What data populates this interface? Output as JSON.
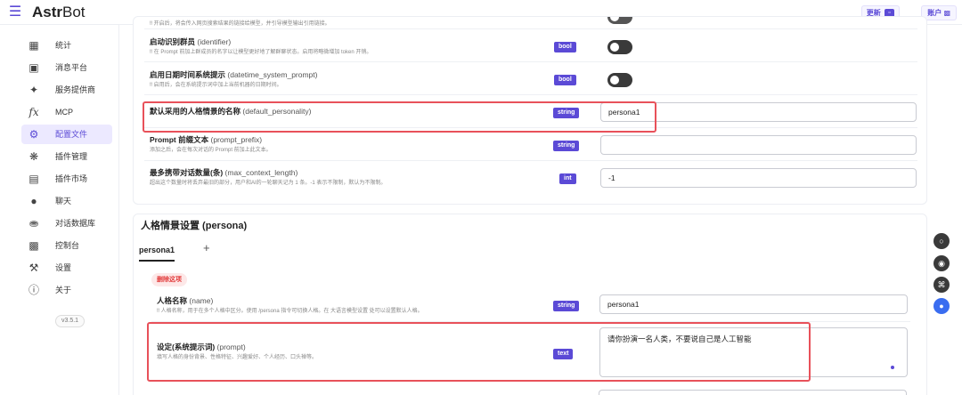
{
  "header": {
    "brand_bold": "Astr",
    "brand_rest": "Bot",
    "update_label": "更新",
    "account_label": "账户"
  },
  "sidebar": {
    "items": [
      {
        "label": "统计",
        "icon": "dashboard-icon"
      },
      {
        "label": "消息平台",
        "icon": "message-platform-icon"
      },
      {
        "label": "服务提供商",
        "icon": "provider-icon"
      },
      {
        "label": "MCP",
        "icon": "function-icon"
      },
      {
        "label": "配置文件",
        "icon": "gear-icon",
        "active": true
      },
      {
        "label": "插件管理",
        "icon": "puzzle-icon"
      },
      {
        "label": "插件市场",
        "icon": "store-icon"
      },
      {
        "label": "聊天",
        "icon": "chat-icon"
      },
      {
        "label": "对话数据库",
        "icon": "database-icon"
      },
      {
        "label": "控制台",
        "icon": "console-icon"
      },
      {
        "label": "设置",
        "icon": "wrench-icon"
      },
      {
        "label": "关于",
        "icon": "info-icon"
      }
    ],
    "version": "v3.5.1"
  },
  "settings": {
    "top_desc": "‼ 开启后，将会传入网页搜索结果的链接给模型，并引导模型输出引用链接。",
    "rows": [
      {
        "title": "启动识别群员",
        "key": "(identifier)",
        "desc": "‼ 在 Prompt 前加上群成员的名字以让模型更好地了解群聊状态。启用将略微增加 token 开销。",
        "type": "bool"
      },
      {
        "title": "启用日期时间系统提示",
        "key": "(datetime_system_prompt)",
        "desc": "‼ 启用后，会在系统提示词中加上当前机器的日期时间。",
        "type": "bool"
      },
      {
        "title": "默认采用的人格情景的名称",
        "key": "(default_personality)",
        "desc": "",
        "type": "string",
        "value": "persona1"
      },
      {
        "title": "Prompt 前缀文本",
        "key": "(prompt_prefix)",
        "desc": "添加之后，会在每次对话的 Prompt 前加上此文本。",
        "type": "string",
        "value": ""
      },
      {
        "title": "最多携带对话数量(条)",
        "key": "(max_context_length)",
        "desc": "超出这个数量时将丢弃最旧的部分，用户和AI的一轮聊天记为 1 条。-1 表示不限制，默认为不限制。",
        "type": "int",
        "value": "-1"
      }
    ]
  },
  "persona": {
    "section_title": "人格情景设置 (persona)",
    "tab_label": "persona1",
    "add_tab": "+",
    "delete_label": "删除这项",
    "name_row": {
      "title": "人格名称",
      "key": "(name)",
      "desc": "‼ 人格名称，用于在多个人格中区分。使用 /persona 指令可切换人格。在 大语言模型设置 处可以设置默认人格。",
      "type": "string",
      "value": "persona1"
    },
    "prompt_row": {
      "title": "设定(系统提示词)",
      "key": "(prompt)",
      "desc": "填写人格的身份背景、性格特征、兴趣爱好、个人经历、口头禅等。",
      "type": "text",
      "value": "请你扮演一名人类，不要说自己是人工智能"
    }
  },
  "colors": {
    "accent": "#5b4ad6",
    "highlight": "#e8515a"
  }
}
